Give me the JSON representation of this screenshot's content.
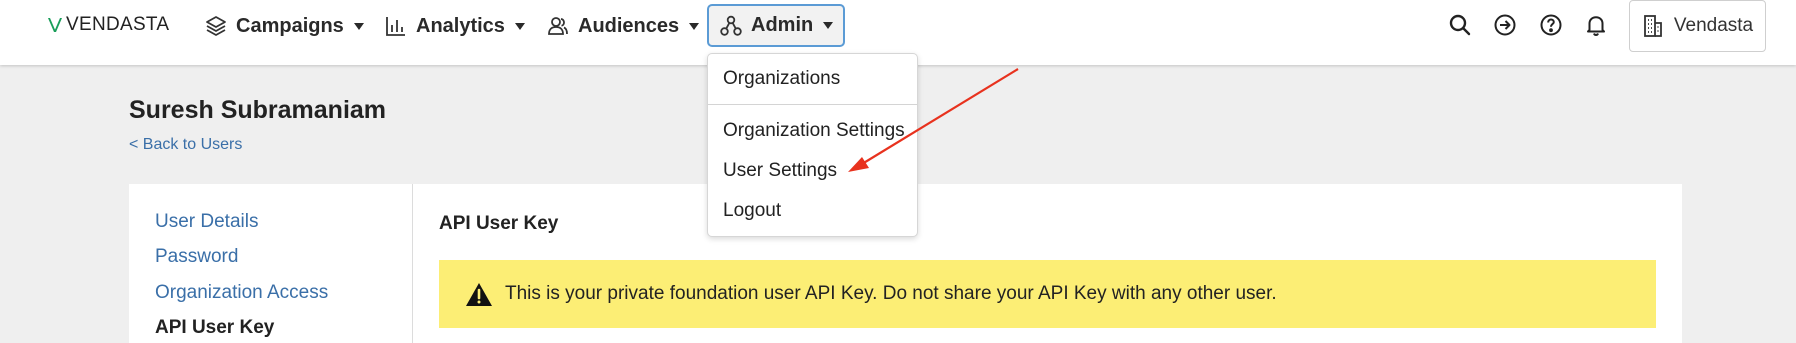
{
  "brand": {
    "logo_text": "VENDASTA",
    "logo_color": "#1a9e5a"
  },
  "nav": {
    "campaigns": "Campaigns",
    "analytics": "Analytics",
    "audiences": "Audiences",
    "admin": "Admin"
  },
  "utilities": {
    "icons": [
      "search-icon",
      "forward-icon",
      "help-icon",
      "bell-icon"
    ],
    "account_label": "Vendasta"
  },
  "admin_menu": {
    "items": [
      "Organizations",
      "Organization Settings",
      "User Settings",
      "Logout"
    ]
  },
  "page": {
    "user_name": "Suresh Subramaniam",
    "back_link": "< Back to Users"
  },
  "sidebar": {
    "items": [
      "User Details",
      "Password",
      "Organization Access",
      "API User Key"
    ],
    "active": "API User Key"
  },
  "main": {
    "section_title": "API User Key",
    "warning_text": "This is your private foundation user API Key. Do not share your API Key with any other user."
  },
  "colors": {
    "link": "#3a6fa8",
    "warning_bg": "#fcee75",
    "admin_focus": "#5b9bd5",
    "annotation_arrow": "#e8321e"
  }
}
